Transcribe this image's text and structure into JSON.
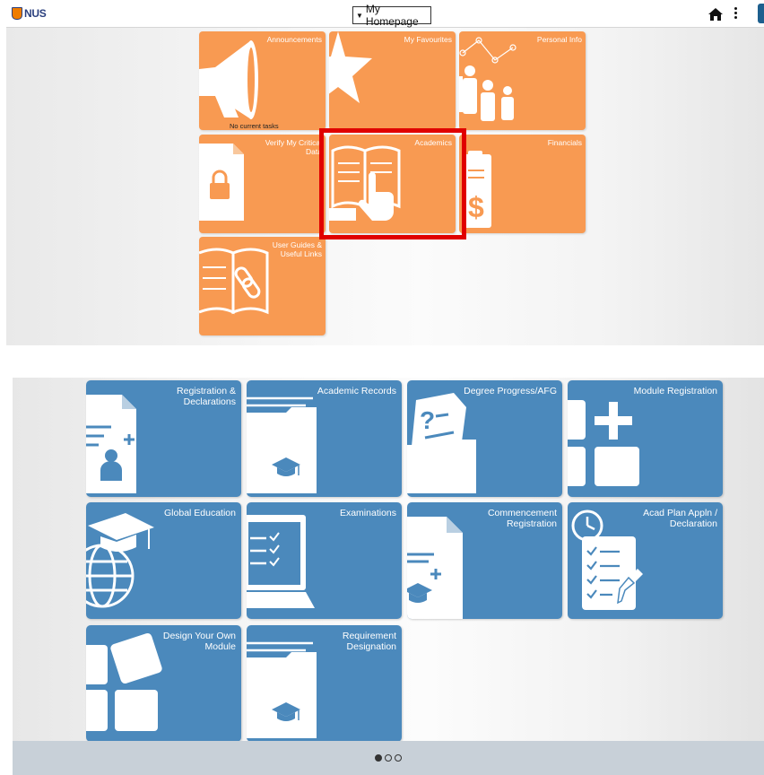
{
  "header": {
    "logo_text": "NUS",
    "homepage_select": "My Homepage"
  },
  "homepage_tiles": [
    {
      "label": "Announcements",
      "icon": "megaphone-icon",
      "subtext": "No current tasks"
    },
    {
      "label": "My Favourites",
      "icon": "star-icon"
    },
    {
      "label": "Personal Info",
      "icon": "people-icon"
    },
    {
      "label": "Verify My Critical Data",
      "icon": "locked-document-icon"
    },
    {
      "label": "Academics",
      "icon": "book-pointing-hand-icon"
    },
    {
      "label": "Financials",
      "icon": "dollar-document-icon"
    },
    {
      "label": "User Guides & Useful Links",
      "icon": "book-link-icon"
    }
  ],
  "academics_tiles": [
    {
      "label": "Registration & Declarations",
      "icon": "registration-document-icon"
    },
    {
      "label": "Academic Records",
      "icon": "folder-graduation-cap-icon"
    },
    {
      "label": "Degree Progress/AFG",
      "icon": "document-question-folder-icon"
    },
    {
      "label": "Module Registration",
      "icon": "blocks-plus-icon"
    },
    {
      "label": "Global Education",
      "icon": "globe-graduation-cap-icon"
    },
    {
      "label": "Examinations",
      "icon": "laptop-checklist-icon"
    },
    {
      "label": "Commencement Registration",
      "icon": "document-graduation-cap-icon"
    },
    {
      "label": "Acad Plan Appln / Declaration",
      "icon": "clock-checklist-pencil-icon"
    },
    {
      "label": "Design Your Own Module",
      "icon": "tilted-blocks-icon"
    },
    {
      "label": "Requirement Designation",
      "icon": "folder-graduation-cap-icon"
    }
  ],
  "pager": {
    "pages": 3,
    "current": 1
  },
  "colors": {
    "homepage_tile": "#f89a52",
    "academics_tile": "#4b89bc",
    "highlight": "#e00000",
    "pager_bar": "#c8d0d8"
  }
}
